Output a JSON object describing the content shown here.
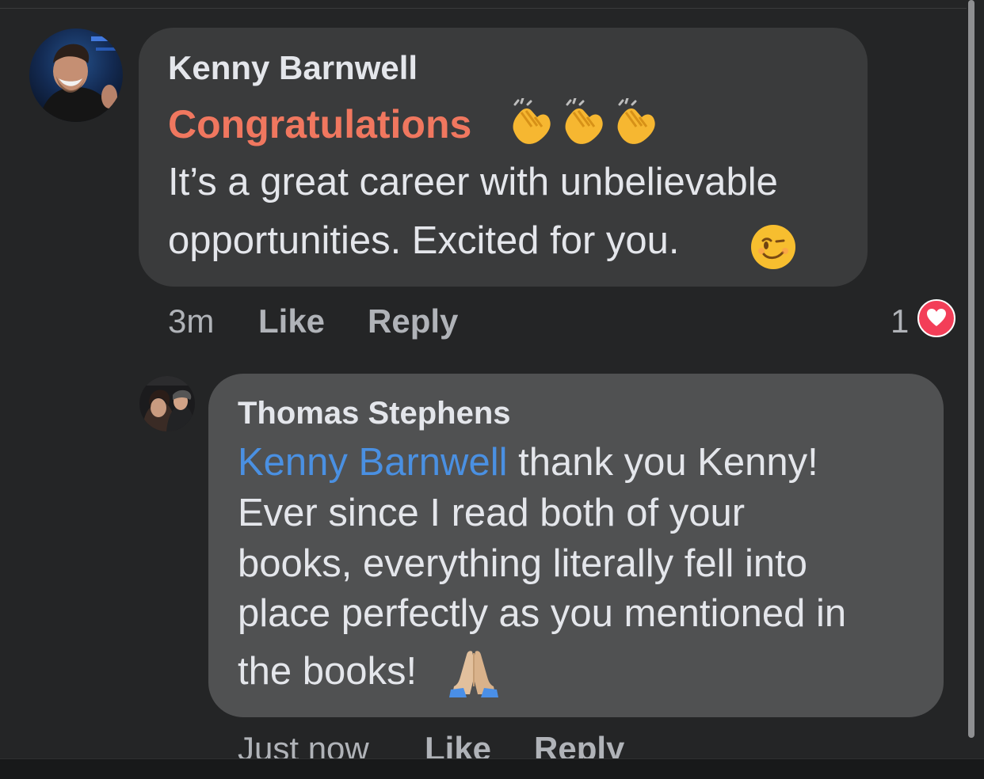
{
  "comments": [
    {
      "author": "Kenny Barnwell",
      "highlight": "Congratulations",
      "lines": [
        "It’s a great career with unbelievable",
        "opportunities. Excited for you."
      ],
      "emojis": [
        "clapping-hands-icon",
        "clapping-hands-icon",
        "clapping-hands-icon",
        "winking-face-icon"
      ],
      "time": "3m",
      "like_label": "Like",
      "reply_label": "Reply",
      "reaction_count": "1",
      "reaction_icon": "heart-icon"
    },
    {
      "author": "Thomas Stephens",
      "mention": "Kenny Barnwell",
      "first_line_rest": " thank you Kenny!",
      "lines": [
        "Ever since I read both of your",
        "books, everything literally fell into",
        "place perfectly as you mentioned in",
        "the books!"
      ],
      "emojis": [
        "folded-hands-icon"
      ],
      "time": "Just now",
      "like_label": "Like",
      "reply_label": "Reply"
    }
  ],
  "colors": {
    "background": "#242526",
    "bubble_primary": "#3a3b3c",
    "bubble_reply": "#505152",
    "congrats_text": "#f0775f",
    "mention_text": "#4a90e2",
    "reaction_heart": "#f33e58"
  }
}
